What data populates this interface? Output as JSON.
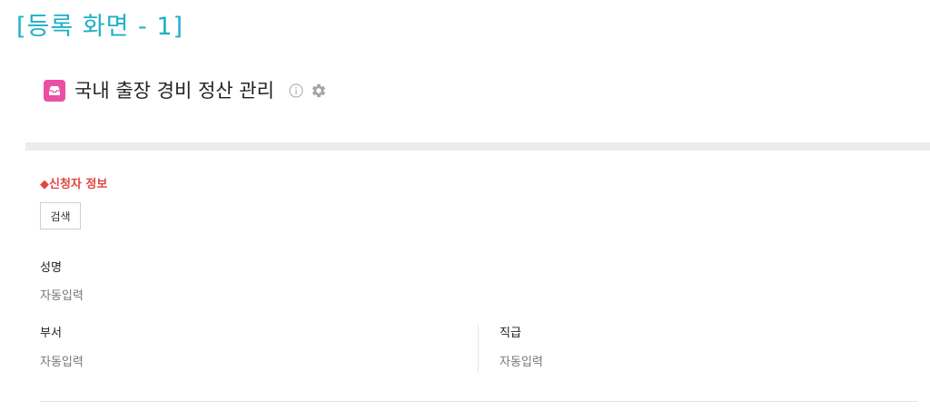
{
  "heading": "[등록 화면 - 1]",
  "app": {
    "title": "국내 출장 경비 정산 관리",
    "icon": "inbox-tray-icon",
    "accent_color": "#ea4fa3"
  },
  "toolbar": {
    "info_icon": "info-icon",
    "settings_icon": "gear-icon"
  },
  "applicant_section": {
    "label": "◆신청자 정보",
    "label_color": "#e0463f",
    "search_button": "검색"
  },
  "fields": {
    "name": {
      "label": "성명",
      "value": "자동입력"
    },
    "department": {
      "label": "부서",
      "value": "자동입력"
    },
    "position": {
      "label": "직급",
      "value": "자동입력"
    }
  }
}
